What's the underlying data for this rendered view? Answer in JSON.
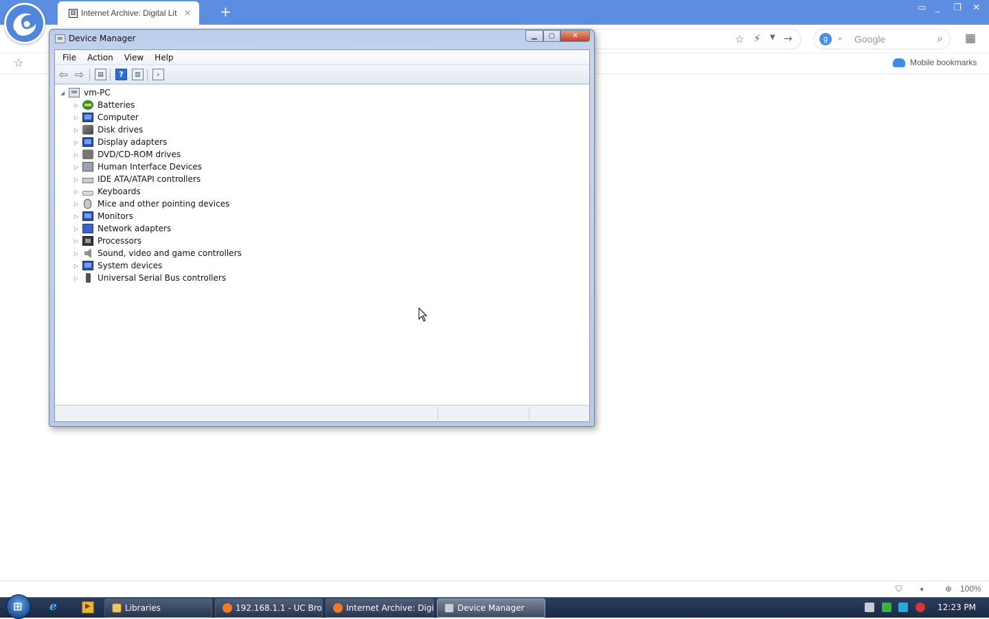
{
  "browser": {
    "tab": {
      "title": "Internet Archive: Digital Lit",
      "favicon": "archive-icon"
    },
    "new_tab_symbol": "+",
    "window_controls": [
      "▭",
      "_",
      "❐",
      "✕"
    ],
    "search": {
      "placeholder": "Google",
      "engine_letter": "g"
    },
    "bookmarks_bar": {
      "mobile_bookmarks": "Mobile bookmarks"
    },
    "status_bar": {
      "zoom": "100%"
    },
    "accent_color": "#5b8de0"
  },
  "device_manager": {
    "title": "Device Manager",
    "menu": [
      "File",
      "Action",
      "View",
      "Help"
    ],
    "tree": {
      "root": "vm-PC",
      "categories": [
        {
          "label": "Batteries",
          "icon": "battery-icon"
        },
        {
          "label": "Computer",
          "icon": "computer-icon"
        },
        {
          "label": "Disk drives",
          "icon": "disk-drive-icon"
        },
        {
          "label": "Display adapters",
          "icon": "display-adapter-icon"
        },
        {
          "label": "DVD/CD-ROM drives",
          "icon": "dvd-drive-icon"
        },
        {
          "label": "Human Interface Devices",
          "icon": "hid-icon"
        },
        {
          "label": "IDE ATA/ATAPI controllers",
          "icon": "ide-controller-icon"
        },
        {
          "label": "Keyboards",
          "icon": "keyboard-icon"
        },
        {
          "label": "Mice and other pointing devices",
          "icon": "mouse-icon"
        },
        {
          "label": "Monitors",
          "icon": "monitor-icon"
        },
        {
          "label": "Network adapters",
          "icon": "network-adapter-icon"
        },
        {
          "label": "Processors",
          "icon": "processor-icon"
        },
        {
          "label": "Sound, video and game controllers",
          "icon": "sound-icon"
        },
        {
          "label": "System devices",
          "icon": "system-devices-icon"
        },
        {
          "label": "Universal Serial Bus controllers",
          "icon": "usb-icon"
        }
      ]
    }
  },
  "taskbar": {
    "buttons": [
      {
        "label": "Libraries",
        "icon": "folder-icon"
      },
      {
        "label": "192.168.1.1 - UC Bro...",
        "icon": "uc-browser-icon"
      },
      {
        "label": "Internet Archive: Digi...",
        "icon": "uc-browser-icon"
      },
      {
        "label": "Device Manager",
        "icon": "device-manager-icon"
      }
    ],
    "clock": "12:23 PM"
  }
}
